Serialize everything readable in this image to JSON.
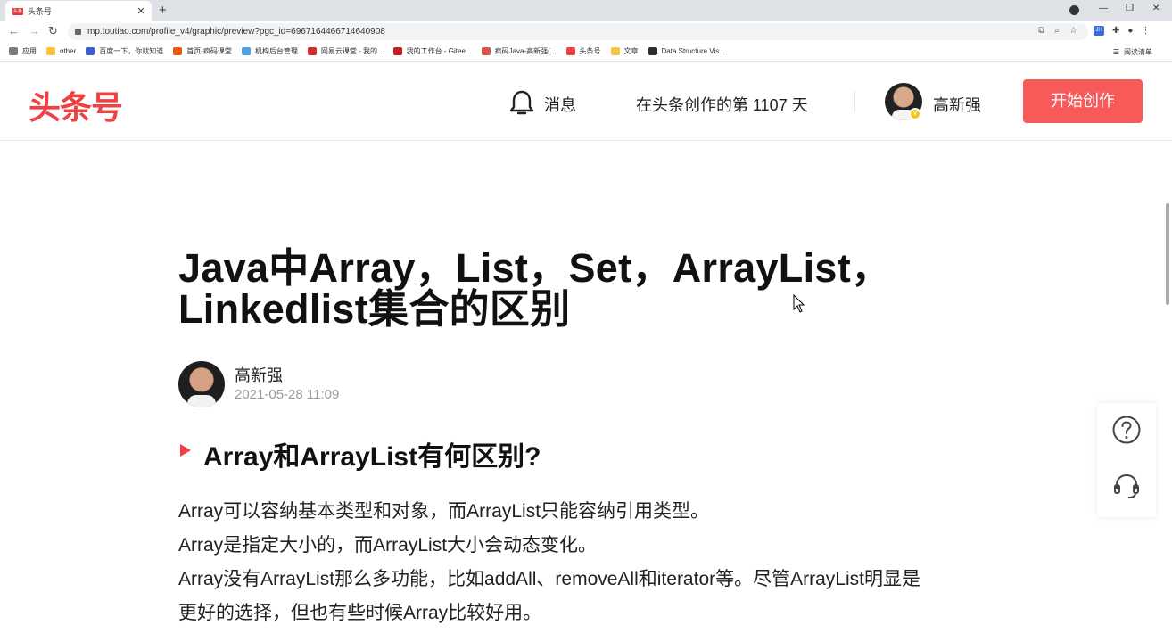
{
  "browser": {
    "tab_title": "头条号",
    "tab_favicon": "头条",
    "url": "mp.toutiao.com/profile_v4/graphic/preview?pgc_id=6967164466714640908",
    "bookmarks": [
      {
        "label": "应用",
        "color": "#7c7c7c"
      },
      {
        "label": "other",
        "color": "#f5c542"
      },
      {
        "label": "百度一下，你就知道",
        "color": "#3a5fcd"
      },
      {
        "label": "首页-疯码课堂",
        "color": "#e8590c"
      },
      {
        "label": "机构后台管理",
        "color": "#4aa3df"
      },
      {
        "label": "网易云课堂 - 我的...",
        "color": "#d62d2d"
      },
      {
        "label": "我的工作台 - Gitee...",
        "color": "#c71d23"
      },
      {
        "label": "疯码Java-高新强(...",
        "color": "#d9534f"
      },
      {
        "label": "头条号",
        "color": "#f04142"
      },
      {
        "label": "文章",
        "color": "#f5c542"
      },
      {
        "label": "Data Structure Vis...",
        "color": "#2e2e2e"
      }
    ],
    "reading_list": "阅读清单",
    "ext_label": "JH"
  },
  "header": {
    "logo": "头条号",
    "messages": "消息",
    "days_text": "在头条创作的第 1107 天",
    "username": "高新强",
    "badge": "V",
    "create_button": "开始创作"
  },
  "article": {
    "title": "Java中Array，List，Set，ArrayList，Linkedlist集合的区别",
    "author": "高新强",
    "date": "2021-05-28 11:09",
    "section_title": "Array和ArrayList有何区别?",
    "paragraphs": [
      "Array可以容纳基本类型和对象，而ArrayList只能容纳引用类型。",
      "Array是指定大小的，而ArrayList大小会动态变化。",
      "Array没有ArrayList那么多功能，比如addAll、removeAll和iterator等。尽管ArrayList明显是",
      "更好的选择，但也有些时候Array比较好用。"
    ]
  },
  "floating": {
    "help_icon": "question-circle-icon",
    "service_icon": "headset-icon"
  },
  "colors": {
    "brand": "#f04142",
    "button": "#f85959"
  }
}
